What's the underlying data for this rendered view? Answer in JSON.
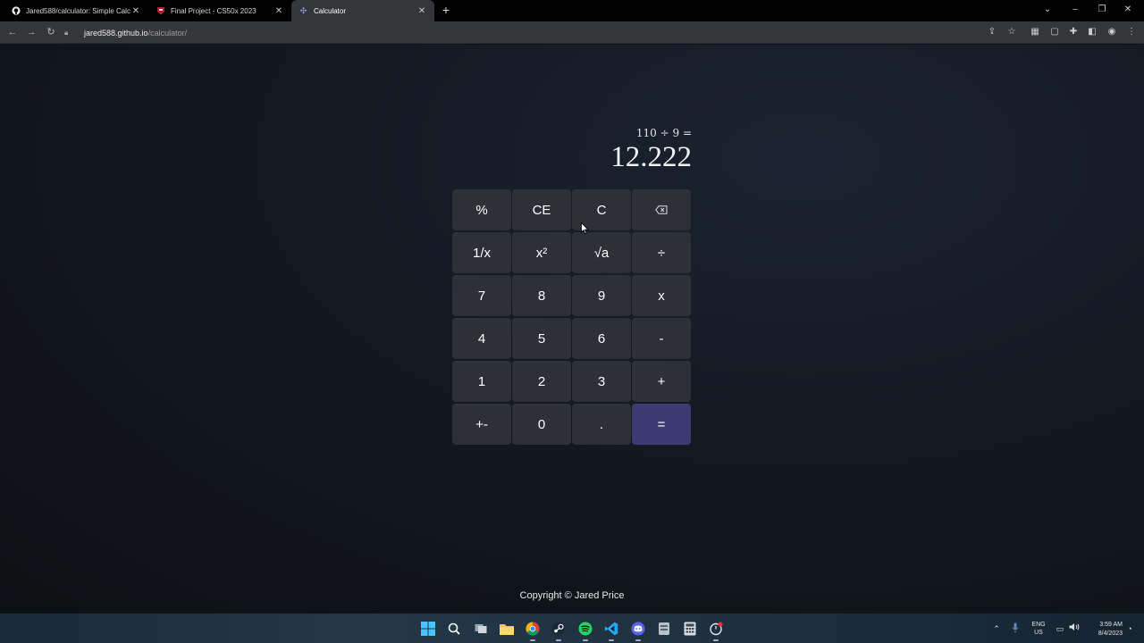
{
  "browser": {
    "tabs": [
      {
        "title": "Jared588/calculator: Simple Calc",
        "icon": "github-icon",
        "active": false
      },
      {
        "title": "Final Project - CS50x 2023",
        "icon": "harvard-icon",
        "active": false
      },
      {
        "title": "Calculator",
        "icon": "calculator-icon",
        "active": true
      }
    ],
    "address": {
      "host": "jared588.github.io",
      "path": "/calculator/"
    }
  },
  "calculator": {
    "expression": "110 ÷ 9 =",
    "result": "12.222",
    "keys": [
      "%",
      "CE",
      "C",
      "⌫",
      "1/x",
      "x²",
      "√a",
      "÷",
      "7",
      "8",
      "9",
      "x",
      "4",
      "5",
      "6",
      "-",
      "1",
      "2",
      "3",
      "+",
      "+-",
      "0",
      ".",
      "="
    ],
    "accent_color": "#3d3a72",
    "key_color": "#2d3036"
  },
  "footer": {
    "text": "Copyright © Jared Price"
  },
  "taskbar": {
    "lang_top": "ENG",
    "lang_bottom": "US",
    "time": "3:59 AM",
    "date": "8/4/2023"
  }
}
